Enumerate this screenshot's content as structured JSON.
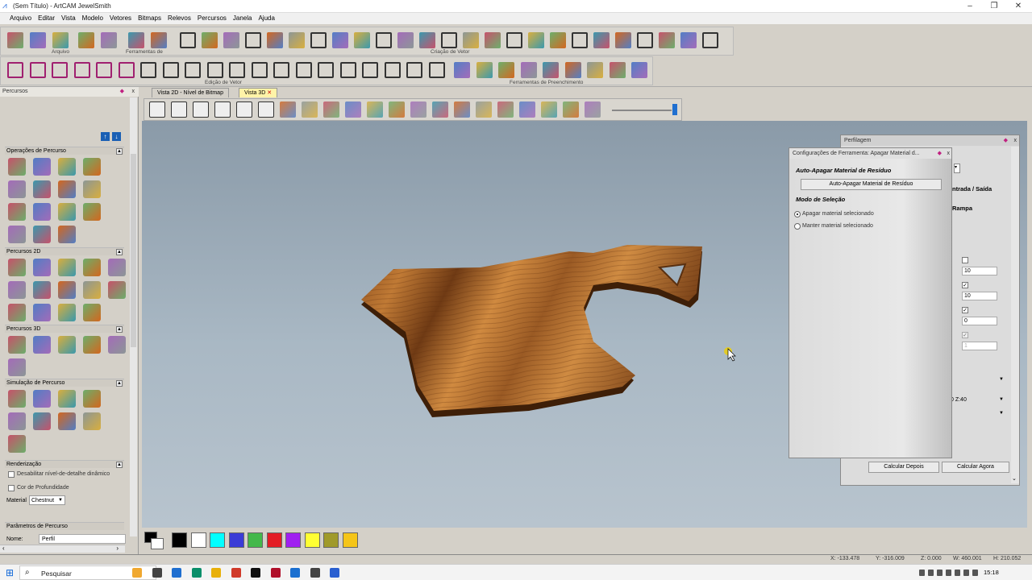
{
  "window": {
    "title": "(Sem Título) - ArtCAM JewelSmith"
  },
  "menu": [
    "Arquivo",
    "Editar",
    "Vista",
    "Modelo",
    "Vetores",
    "Bitmaps",
    "Relevos",
    "Percursos",
    "Janela",
    "Ajuda"
  ],
  "toolbar_groups": {
    "arquivo": "Arquivo",
    "ferramentas": "Ferramentas de",
    "criacao_vetor": "Criação de Vetor",
    "edicao_vetor": "Edição de Vetor",
    "preenchimento": "Ferramentas de Preenchimento"
  },
  "left_panel": {
    "title": "Percursos",
    "sections": {
      "operacoes": "Operações de Percurso",
      "percursos2d": "Percursos 2D",
      "percursos3d": "Percursos 3D",
      "simulacao": "Simulação de Percurso",
      "renderizacao": "Renderização",
      "parametros": "Parâmetros de Percurso"
    },
    "render_options": {
      "disable_detail": "Desabilitar nível-de-detalhe dinâmico",
      "depth_color": "Cor de Profundidade",
      "material_label": "Material",
      "material_value": "Chestnut"
    },
    "name_label": "Nome:",
    "name_value": "Perfil"
  },
  "tabs": [
    {
      "label": "Vista 2D - Nível de Bitmap",
      "active": false
    },
    {
      "label": "Vista 3D",
      "active": true
    }
  ],
  "profile_panel": {
    "title": "Perfilagem",
    "entry_exit": "ntrada / Saída",
    "ramp": "Rampa",
    "values": [
      "10",
      "10",
      "0",
      "1"
    ],
    "z_readout": "0 Z:40",
    "calc_later": "Calcular Depois",
    "calc_now": "Calcular Agora"
  },
  "tool_config_dialog": {
    "title": "Configurações de Ferramenta: Apagar Material d...",
    "section1": "Auto-Apagar Material de Resíduo",
    "button": "Auto-Apagar Material de Resíduo",
    "section2": "Modo de Seleção",
    "option1": "Apagar material selecionado",
    "option2": "Manter material selecionado"
  },
  "palette_colors": [
    "#000000",
    "#ffffff",
    "#00ffff",
    "#3b3bd6",
    "#44b84a",
    "#e31c24",
    "#a020f0",
    "#ffff33",
    "#a09a2a",
    "#f5c518"
  ],
  "status": {
    "x": "X: -133.478",
    "y": "Y: -316.009",
    "z": "Z: 0.000",
    "w": "W: 460.001",
    "h": "H: 210.052"
  },
  "taskbar": {
    "search": "Pesquisar",
    "time": "15:18"
  }
}
